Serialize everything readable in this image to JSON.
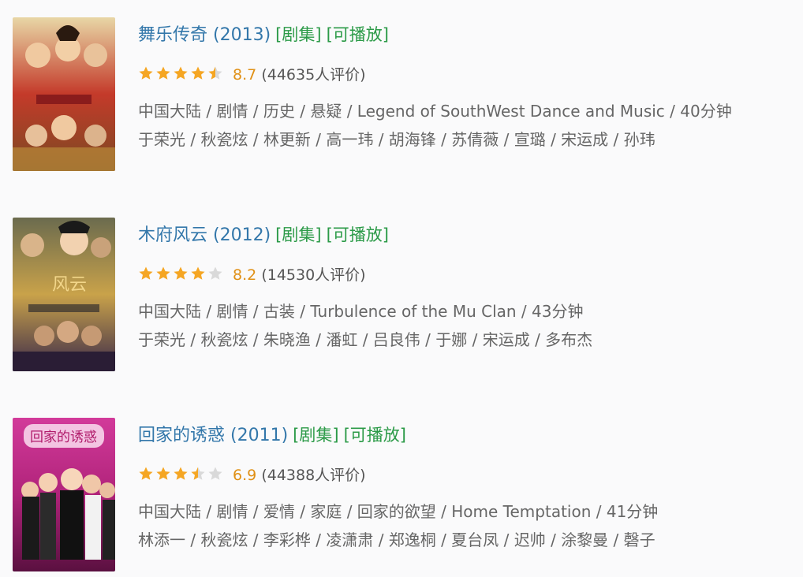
{
  "items": [
    {
      "title": "舞乐传奇",
      "year": "(2013)",
      "tag_type": "[剧集]",
      "tag_play": "[可播放]",
      "score": "8.7",
      "stars": 4.5,
      "votes": "(44635人评价)",
      "meta": "中国大陆 / 剧情 / 历史 / 悬疑 / Legend of SouthWest Dance and Music / 40分钟",
      "cast": "于荣光 / 秋瓷炫 / 林更新 / 高一玮 / 胡海锋 / 苏倩薇 / 宣璐 / 宋运成 / 孙玮",
      "poster_colors": {
        "top": "#e8d7a6",
        "mid": "#c43a2a",
        "bottom": "#7a4a22"
      }
    },
    {
      "title": "木府风云",
      "year": "(2012)",
      "tag_type": "[剧集]",
      "tag_play": "[可播放]",
      "score": "8.2",
      "stars": 4,
      "votes": "(14530人评价)",
      "meta": "中国大陆 / 剧情 / 古装 / Turbulence of the Mu Clan / 43分钟",
      "cast": "于荣光 / 秋瓷炫 / 朱晓渔 / 潘虹 / 吕良伟 / 于娜 / 宋运成 / 多布杰",
      "poster_colors": {
        "top": "#6b6b4e",
        "mid": "#c9a24a",
        "bottom": "#3b2a4a"
      }
    },
    {
      "title": "回家的诱惑",
      "year": "(2011)",
      "tag_type": "[剧集]",
      "tag_play": "[可播放]",
      "score": "6.9",
      "stars": 3.5,
      "votes": "(44388人评价)",
      "meta": "中国大陆 / 剧情 / 爱情 / 家庭 / 回家的欲望 / Home Temptation / 41分钟",
      "cast": "林添一 / 秋瓷炫 / 李彩桦 / 凌潇肃 / 郑逸桐 / 夏台凤 / 迟帅 / 涂黎曼 / 磬子",
      "poster_colors": {
        "top": "#d23a9a",
        "mid": "#b0237a",
        "bottom": "#5a1040"
      }
    }
  ],
  "colors": {
    "title_link": "#3377aa",
    "tag_green": "#2b9a47",
    "score_orange": "#e09015",
    "star_filled": "#f5a623",
    "star_empty": "#d9d9d9",
    "meta_gray": "#666666"
  }
}
